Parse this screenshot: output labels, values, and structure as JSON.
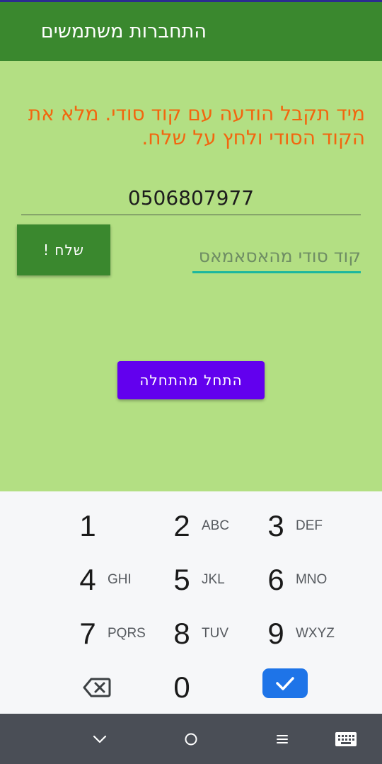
{
  "app": {
    "title": "התחברות משתמשים",
    "accent_color": "#3a882e",
    "background_color": "#b3df83"
  },
  "main": {
    "message": "מיד תקבל הודעה עם קוד סודי. מלא את הקוד הסודי ולחץ על שלח.",
    "message_color": "#f2660f",
    "phone_value": "0506807977",
    "send_button_label": "שלח !",
    "code_placeholder": "קוד סודי מהאסאמאס",
    "code_value": "",
    "restart_button_label": "התחל מהתחלה",
    "restart_button_color": "#6200ee"
  },
  "keyboard": {
    "keys": [
      {
        "digit": "1",
        "letters": ""
      },
      {
        "digit": "2",
        "letters": "ABC"
      },
      {
        "digit": "3",
        "letters": "DEF"
      },
      {
        "digit": "4",
        "letters": "GHI"
      },
      {
        "digit": "5",
        "letters": "JKL"
      },
      {
        "digit": "6",
        "letters": "MNO"
      },
      {
        "digit": "7",
        "letters": "PQRS"
      },
      {
        "digit": "8",
        "letters": "TUV"
      },
      {
        "digit": "9",
        "letters": "WXYZ"
      },
      {
        "digit": "0",
        "letters": ""
      }
    ],
    "backspace_icon": "backspace-icon",
    "done_icon": "checkmark-icon",
    "done_color": "#1e74e8"
  },
  "navbar": {
    "icons": [
      "chevron-down-icon",
      "home-circle-icon",
      "menu-icon",
      "keyboard-icon"
    ]
  }
}
